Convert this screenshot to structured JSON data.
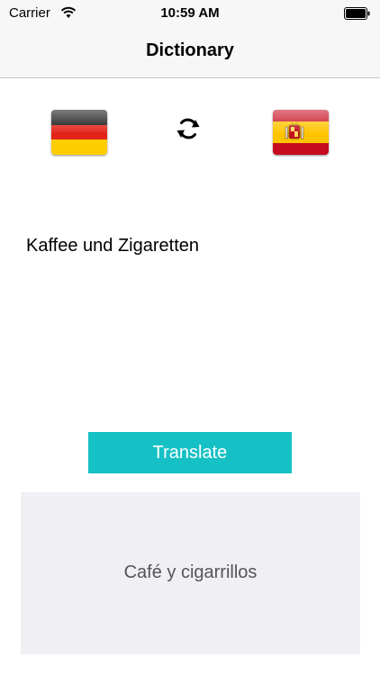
{
  "status_bar": {
    "carrier": "Carrier",
    "time": "10:59 AM",
    "wifi_icon": "wifi-icon",
    "battery_icon": "battery-icon"
  },
  "nav": {
    "title": "Dictionary"
  },
  "languages": {
    "source_flag": "germany-flag-icon",
    "target_flag": "spain-flag-icon",
    "swap_icon": "refresh-swap-icon"
  },
  "input": {
    "text": "Kaffee und Zigaretten"
  },
  "actions": {
    "translate_label": "Translate"
  },
  "result": {
    "text": "Café y cigarrillos"
  },
  "colors": {
    "accent": "#16c1c5",
    "result_background": "#efeff4",
    "bar_background": "#f7f7f7"
  }
}
